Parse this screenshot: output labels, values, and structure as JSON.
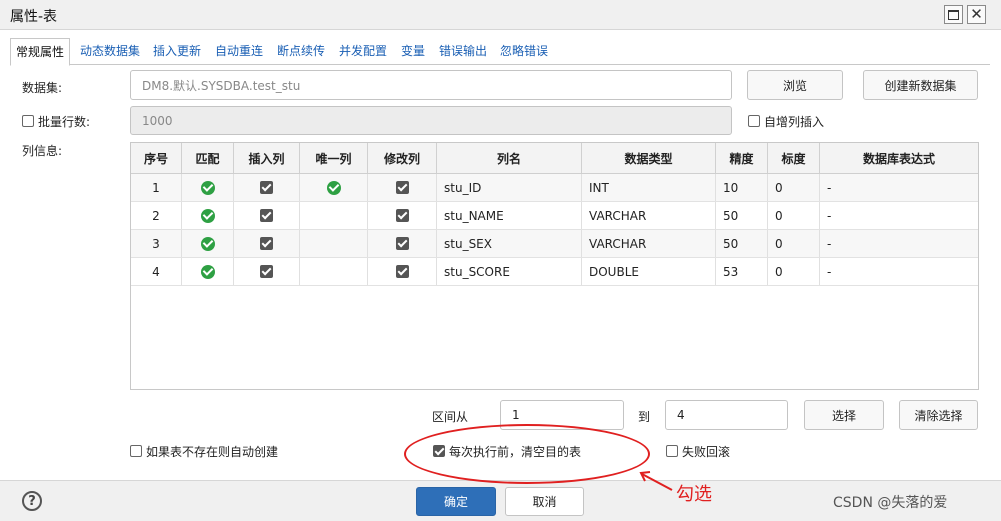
{
  "window": {
    "title": "属性-表"
  },
  "tabs": [
    "常规属性",
    "动态数据集",
    "插入更新",
    "自动重连",
    "断点续传",
    "并发配置",
    "变量",
    "错误输出",
    "忽略错误"
  ],
  "form": {
    "dataset_label": "数据集:",
    "dataset_value": "DM8.默认.SYSDBA.test_stu",
    "browse_button": "浏览",
    "create_button": "创建新数据集",
    "batch_label": "批量行数:",
    "batch_value": "1000",
    "autoinc_label": "自增列插入",
    "colinfo_label": "列信息:"
  },
  "table": {
    "headers": [
      "序号",
      "匹配",
      "插入列",
      "唯一列",
      "修改列",
      "列名",
      "数据类型",
      "精度",
      "标度",
      "数据库表达式"
    ],
    "rows": [
      {
        "idx": "1",
        "match": true,
        "insert": true,
        "unique": true,
        "modify": true,
        "name": "stu_ID",
        "type": "INT",
        "precision": "10",
        "scale": "0",
        "expr": "-"
      },
      {
        "idx": "2",
        "match": true,
        "insert": true,
        "unique": false,
        "modify": true,
        "name": "stu_NAME",
        "type": "VARCHAR",
        "precision": "50",
        "scale": "0",
        "expr": "-"
      },
      {
        "idx": "3",
        "match": true,
        "insert": true,
        "unique": false,
        "modify": true,
        "name": "stu_SEX",
        "type": "VARCHAR",
        "precision": "50",
        "scale": "0",
        "expr": "-"
      },
      {
        "idx": "4",
        "match": true,
        "insert": true,
        "unique": false,
        "modify": true,
        "name": "stu_SCORE",
        "type": "DOUBLE",
        "precision": "53",
        "scale": "0",
        "expr": "-"
      }
    ]
  },
  "range": {
    "from_label": "区间从",
    "from_value": "1",
    "to_label": "到",
    "to_value": "4",
    "select_button": "选择",
    "clear_button": "清除选择"
  },
  "options": {
    "auto_create_label": "如果表不存在则自动创建",
    "clear_target_label": "每次执行前，清空目的表",
    "rollback_label": "失败回滚"
  },
  "footer": {
    "help_symbol": "?",
    "ok_button": "确定",
    "cancel_button": "取消",
    "watermark": "CSDN @失落的爱"
  },
  "annotation": {
    "text": "勾选",
    "color": "#e02020"
  }
}
